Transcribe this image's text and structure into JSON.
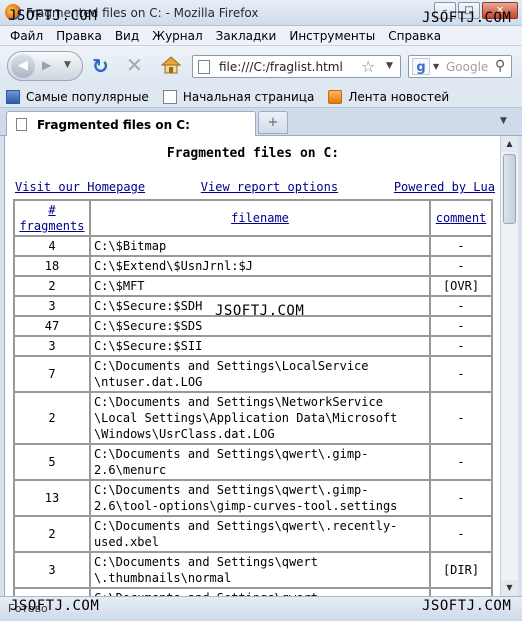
{
  "window": {
    "title": "Fragmented files on C: - Mozilla Firefox",
    "watermark": "JSOFTJ.COM",
    "buttons": {
      "minimize": "–",
      "maximize": "□",
      "close": "✕"
    }
  },
  "menu": [
    "Файл",
    "Правка",
    "Вид",
    "Журнал",
    "Закладки",
    "Инструменты",
    "Справка"
  ],
  "nav": {
    "back_icon": "◀",
    "forward_icon": "▶",
    "reload_icon": "↻",
    "stop_icon": "✕",
    "url": "file:///C:/fraglist.html",
    "search_placeholder": "Google",
    "search_engine_icon": "g"
  },
  "bookmarks": [
    "Самые популярные",
    "Начальная страница",
    "Лента новостей"
  ],
  "tab": {
    "label": "Fragmented files on C:",
    "new_tab_icon": "+"
  },
  "page": {
    "title": "Fragmented files on C:",
    "links": {
      "homepage": "Visit our Homepage",
      "options": "View report options",
      "powered": "Powered by Lua"
    },
    "table": {
      "headers": {
        "fragments": "#\nfragments",
        "filename": "filename",
        "comment": "comment"
      },
      "rows": [
        {
          "fragments": "4",
          "filename": "C:\\$Bitmap",
          "comment": "-"
        },
        {
          "fragments": "18",
          "filename": "C:\\$Extend\\$UsnJrnl:$J",
          "comment": "-"
        },
        {
          "fragments": "2",
          "filename": "C:\\$MFT",
          "comment": "[OVR]"
        },
        {
          "fragments": "3",
          "filename": "C:\\$Secure:$SDH",
          "comment": "-"
        },
        {
          "fragments": "47",
          "filename": "C:\\$Secure:$SDS",
          "comment": "-"
        },
        {
          "fragments": "3",
          "filename": "C:\\$Secure:$SII",
          "comment": "-"
        },
        {
          "fragments": "7",
          "filename": "C:\\Documents and Settings\\LocalService\n\\ntuser.dat.LOG",
          "comment": "-"
        },
        {
          "fragments": "2",
          "filename": "C:\\Documents and Settings\\NetworkService\n\\Local Settings\\Application Data\\Microsoft\n\\Windows\\UsrClass.dat.LOG",
          "comment": "-"
        },
        {
          "fragments": "5",
          "filename": "C:\\Documents and Settings\\qwert\\.gimp-\n2.6\\menurc",
          "comment": "-"
        },
        {
          "fragments": "13",
          "filename": "C:\\Documents and Settings\\qwert\\.gimp-\n2.6\\tool-options\\gimp-curves-tool.settings",
          "comment": "-"
        },
        {
          "fragments": "2",
          "filename": "C:\\Documents and Settings\\qwert\\.recently-\nused.xbel",
          "comment": "-"
        },
        {
          "fragments": "3",
          "filename": "C:\\Documents and Settings\\qwert\n\\.thumbnails\\normal",
          "comment": "[DIR]"
        },
        {
          "fragments": "",
          "filename": "C:\\Documents and Settings\\qwert",
          "comment": ""
        }
      ]
    }
  },
  "status": "Готово"
}
